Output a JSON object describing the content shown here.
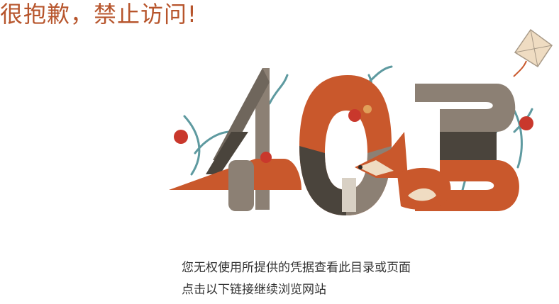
{
  "headline": {
    "text": "很抱歉，禁止访问!",
    "color": "#b7552c"
  },
  "illustration": {
    "numerals": "403",
    "icons": [
      "four-numeral",
      "zero-numeral",
      "three-numeral",
      "fox-icon",
      "kite-icon",
      "apple-icon",
      "branch-icon"
    ],
    "colors": {
      "rust": "#c9582c",
      "taupe": "#8c8074",
      "dark": "#4a443c",
      "teal": "#5e9aa0",
      "cream": "#efdcc2"
    }
  },
  "message": {
    "line1": "您无权使用所提供的凭据查看此目录或页面",
    "line2": "点击以下链接继续浏览网站"
  }
}
